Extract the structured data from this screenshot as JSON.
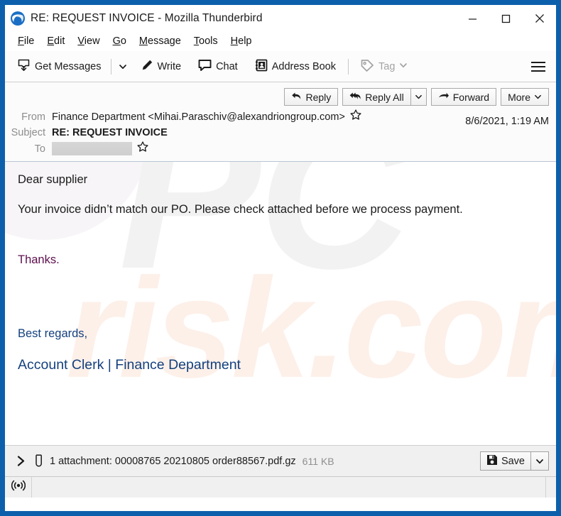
{
  "window": {
    "title": "RE: REQUEST INVOICE - Mozilla Thunderbird",
    "app_icon": "thunderbird-icon",
    "controls": {
      "minimize": "minimize-icon",
      "maximize": "maximize-icon",
      "close": "close-icon"
    },
    "frame_color": "#0c5fab"
  },
  "menubar": {
    "items": [
      {
        "label": "File",
        "accel": "F"
      },
      {
        "label": "Edit",
        "accel": "E"
      },
      {
        "label": "View",
        "accel": "V"
      },
      {
        "label": "Go",
        "accel": "G"
      },
      {
        "label": "Message",
        "accel": "M"
      },
      {
        "label": "Tools",
        "accel": "T"
      },
      {
        "label": "Help",
        "accel": "H"
      }
    ]
  },
  "toolbar": {
    "get_messages": "Get Messages",
    "write": "Write",
    "chat": "Chat",
    "address_book": "Address Book",
    "tag": "Tag",
    "tag_disabled": true,
    "app_menu": "app-menu-icon"
  },
  "message_actions": {
    "reply": "Reply",
    "reply_all": "Reply All",
    "forward": "Forward",
    "more": "More"
  },
  "headers": {
    "from_label": "From",
    "from_value": "Finance Department <Mihai.Paraschiv@alexandriongroup.com>",
    "subject_label": "Subject",
    "subject_value": "RE: REQUEST INVOICE",
    "to_label": "To",
    "to_value": "",
    "date": "8/6/2021, 1:19 AM"
  },
  "body": {
    "greeting": "Dear supplier",
    "paragraph": "Your invoice didn’t match our PO. Please check attached before we process payment.",
    "thanks": "Thanks.",
    "regards": "Best regards,",
    "signature": "Account Clerk | Finance Department",
    "thanks_color": "#5e0f4e",
    "signature_color": "#14407e"
  },
  "watermark": {
    "top": "PC",
    "bottom": "risk.com"
  },
  "attachment": {
    "summary": "1 attachment: 00008765 20210805 order88567.pdf.gz",
    "size": "611 KB",
    "save_label": "Save"
  },
  "statusbar": {
    "icon": "broadcast-icon"
  }
}
